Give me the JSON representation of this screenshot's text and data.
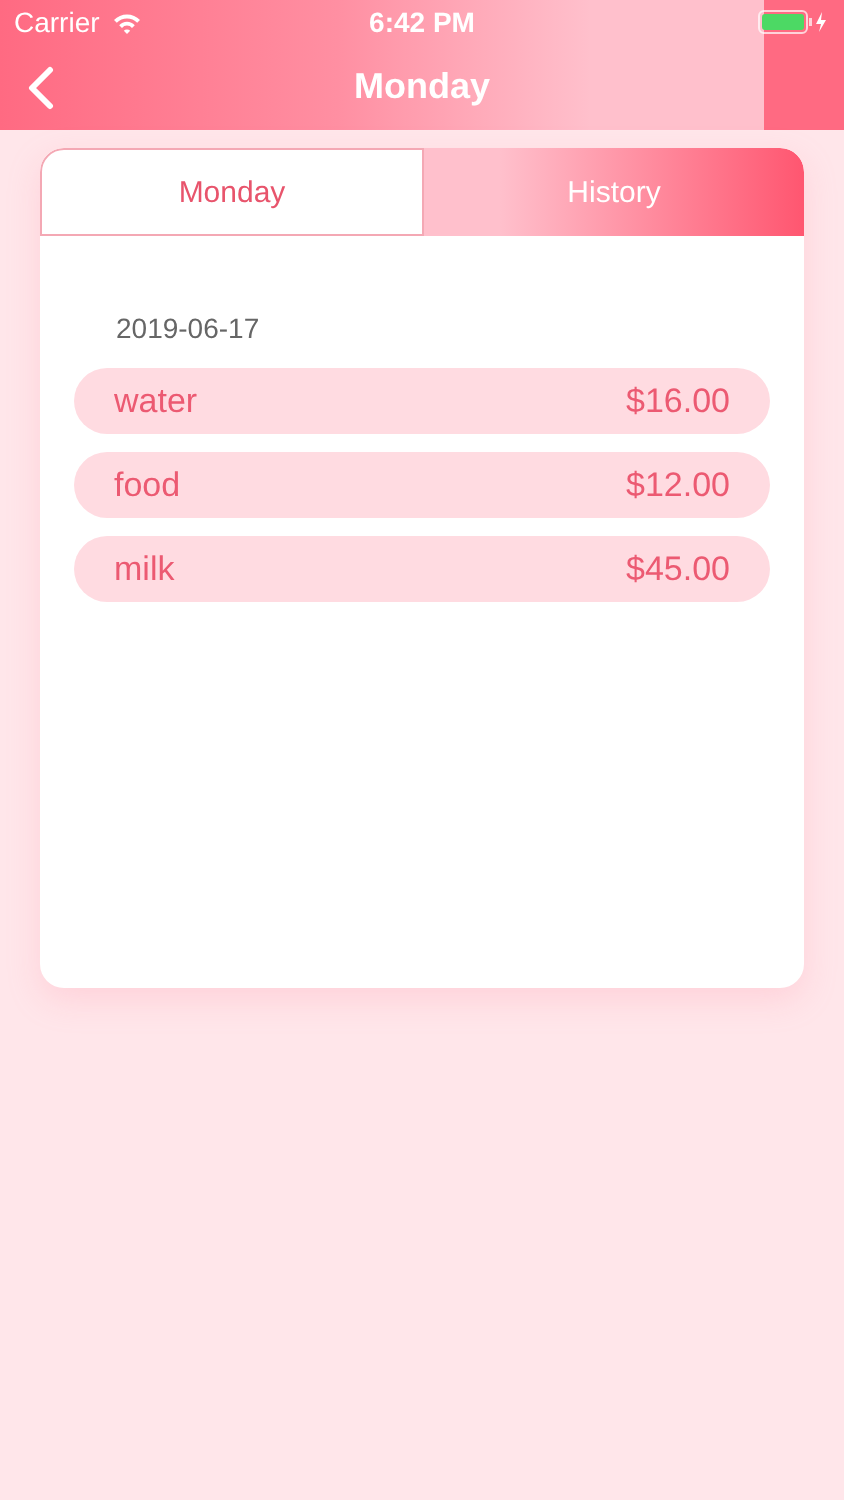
{
  "status_bar": {
    "carrier": "Carrier",
    "time": "6:42 PM"
  },
  "nav": {
    "title": "Monday"
  },
  "tabs": [
    {
      "label": "Monday",
      "selected": true
    },
    {
      "label": "History",
      "selected": false
    }
  ],
  "date": "2019-06-17",
  "items": [
    {
      "name": "water",
      "amount": "$16.00"
    },
    {
      "name": "food",
      "amount": "$12.00"
    },
    {
      "name": "milk",
      "amount": "$45.00"
    }
  ]
}
